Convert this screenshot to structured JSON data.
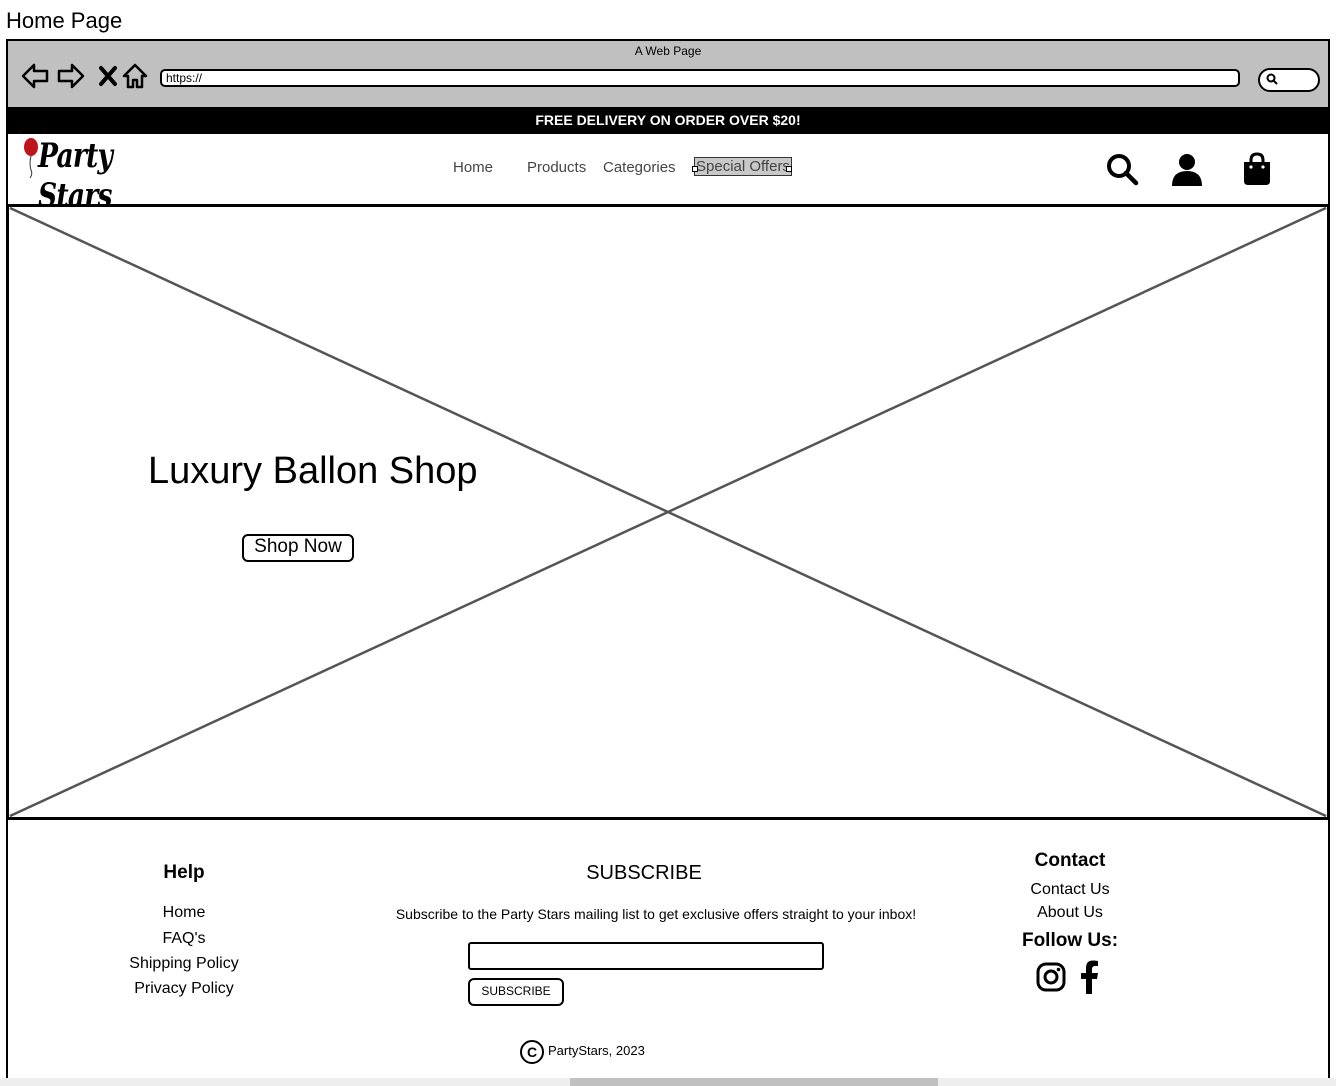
{
  "page": {
    "label": "Home Page"
  },
  "browser": {
    "window_title": "A Web Page",
    "url": "https://",
    "icons": [
      "back-arrow-icon",
      "forward-arrow-icon",
      "close-x-icon",
      "home-icon",
      "search-icon"
    ]
  },
  "promo": {
    "text": "FREE DELIVERY ON ORDER OVER $20!"
  },
  "header": {
    "logo": "Party Stars",
    "logo_accent_color": "#c0141c",
    "nav": [
      {
        "label": "Home"
      },
      {
        "label": "Products"
      },
      {
        "label": "Categories"
      },
      {
        "label": "Special Offers",
        "selected": true
      }
    ],
    "icons": [
      "search-icon",
      "user-icon",
      "shopping-bag-icon"
    ]
  },
  "hero": {
    "placeholder": "image",
    "title": "Luxury Ballon Shop",
    "button": "Shop Now"
  },
  "footer": {
    "help": {
      "heading": "Help",
      "links": [
        "Home",
        "FAQ's",
        "Shipping Policy",
        "Privacy Policy"
      ]
    },
    "subscribe": {
      "heading": "SUBSCRIBE",
      "text": "Subscribe to the Party Stars mailing list to get exclusive offers straight to your inbox!",
      "input_value": "",
      "button": "SUBSCRIBE"
    },
    "contact": {
      "heading": "Contact",
      "links": [
        "Contact Us",
        "About Us"
      ],
      "follow_heading": "Follow Us:",
      "social": [
        "instagram-icon",
        "facebook-icon"
      ]
    },
    "copyright": {
      "symbol": "C",
      "text": "PartyStars, 2023"
    }
  }
}
